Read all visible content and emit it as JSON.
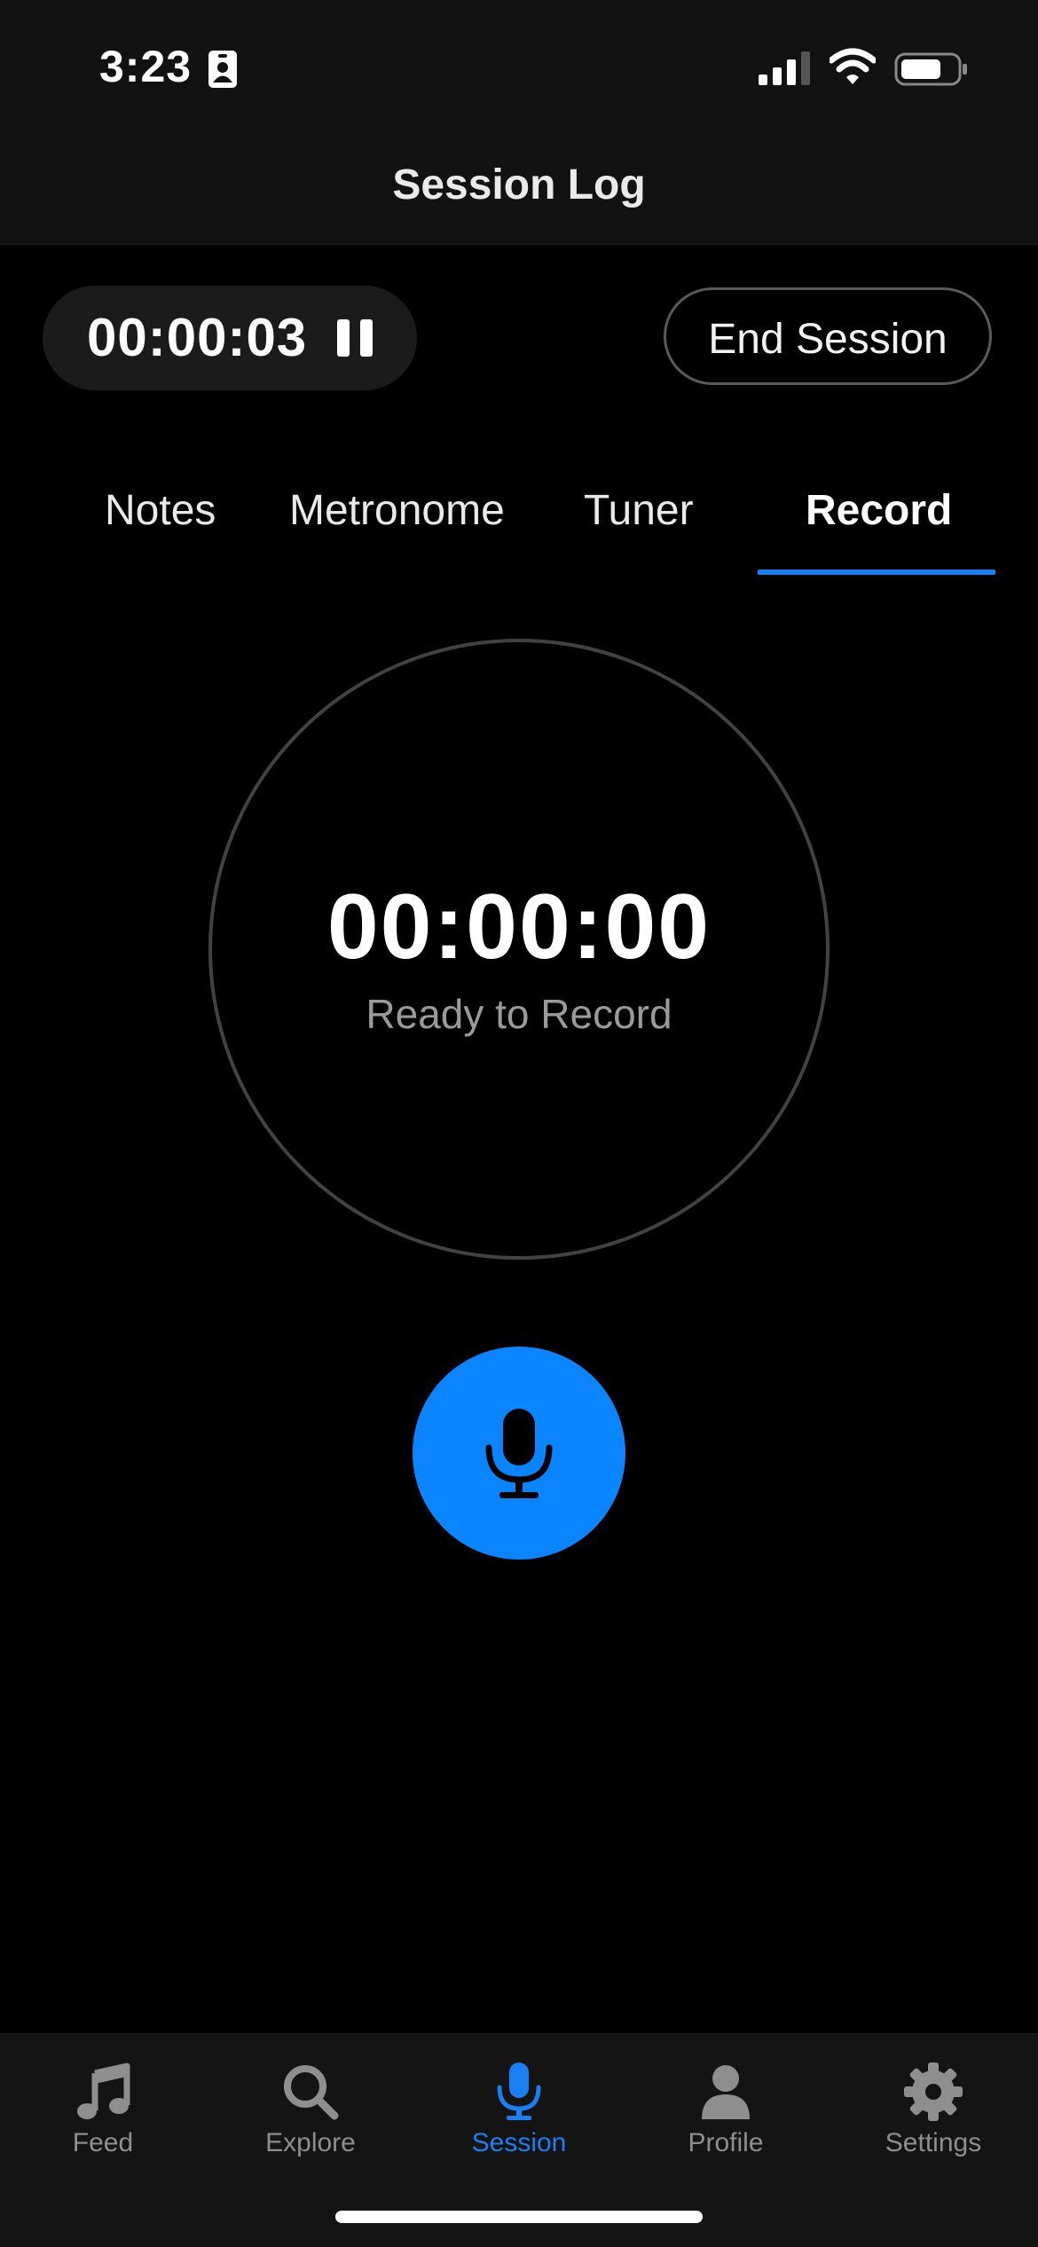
{
  "status_bar": {
    "time": "3:23"
  },
  "nav": {
    "title": "Session Log"
  },
  "session": {
    "timer": "00:00:03",
    "end_label": "End Session"
  },
  "tabs": [
    {
      "label": "Notes"
    },
    {
      "label": "Metronome"
    },
    {
      "label": "Tuner"
    },
    {
      "label": "Record",
      "active": true
    }
  ],
  "recorder": {
    "time": "00:00:00",
    "status": "Ready to Record"
  },
  "tab_bar": [
    {
      "label": "Feed",
      "icon": "music-note-icon"
    },
    {
      "label": "Explore",
      "icon": "search-icon"
    },
    {
      "label": "Session",
      "icon": "mic-icon",
      "active": true
    },
    {
      "label": "Profile",
      "icon": "person-icon"
    },
    {
      "label": "Settings",
      "icon": "gear-icon"
    }
  ],
  "colors": {
    "accent": "#0a84ff",
    "background": "#000000",
    "bar": "#121212"
  }
}
